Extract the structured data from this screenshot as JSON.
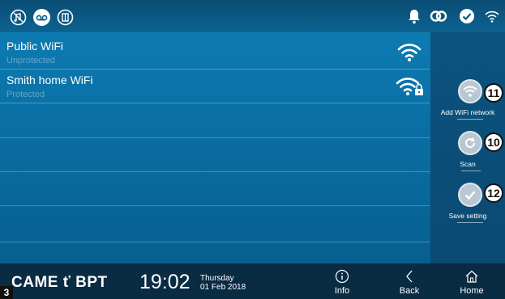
{
  "status_bar": {
    "left_icons": [
      "music-off-icon",
      "voicemail-icon",
      "door-icon"
    ],
    "right_icons": [
      "bell-icon",
      "link-icon",
      "check-icon",
      "wifi-icon"
    ]
  },
  "networks": [
    {
      "name": "Public WiFi",
      "security": "Unprotected",
      "icon": "wifi-open-icon"
    },
    {
      "name": "Smith home WiFi",
      "security": "Protected",
      "icon": "wifi-locked-icon"
    }
  ],
  "side_actions": [
    {
      "label": "Add WiFi network",
      "callout": "11",
      "icon": "add-wifi-icon"
    },
    {
      "label": "Scan",
      "callout": "10",
      "icon": "refresh-icon"
    },
    {
      "label": "Save setting",
      "callout": "12",
      "icon": "checkmark-icon"
    }
  ],
  "footer": {
    "brand": "CAME ť BPT",
    "time": "19:02",
    "day": "Thursday",
    "date": "01 Feb 2018",
    "nav": [
      {
        "label": "Info",
        "icon": "info-icon"
      },
      {
        "label": "Back",
        "icon": "back-icon"
      },
      {
        "label": "Home",
        "icon": "home-icon"
      }
    ]
  },
  "figure_number": "3",
  "colors": {
    "background": "#0a6ea3",
    "topbar": "#0a4d75",
    "side_panel": "#0b537f",
    "footer": "#0a2c43"
  }
}
